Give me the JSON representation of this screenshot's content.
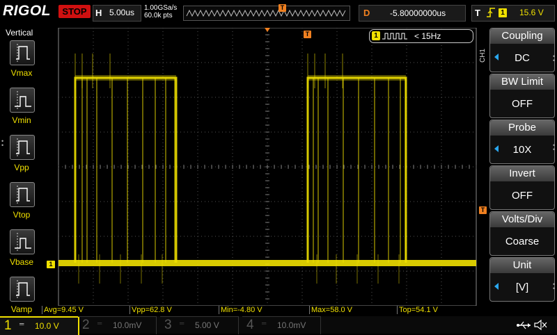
{
  "header": {
    "logo": "RIGOL",
    "run_status": "STOP",
    "timebase_letter": "H",
    "timebase_scale": "5.00us",
    "sample_rate": "1.00GSa/s",
    "memory_depth": "60.0k pts",
    "trigger_marker": "T",
    "delay_letter": "D",
    "delay_value": "-5.80000000us",
    "trigger_letter": "T",
    "trigger_edge": "rising-edge-icon",
    "trigger_channel": "1",
    "trigger_level": "15.6 V"
  },
  "left_panel": {
    "title": "Vertical",
    "items": [
      {
        "label": "Vmax",
        "icon": "vmax-icon"
      },
      {
        "label": "Vmin",
        "icon": "vmin-icon"
      },
      {
        "label": "Vpp",
        "icon": "vpp-icon"
      },
      {
        "label": "Vtop",
        "icon": "vtop-icon"
      },
      {
        "label": "Vbase",
        "icon": "vbase-icon"
      },
      {
        "label": "Vamp",
        "icon": "vamp-icon"
      }
    ]
  },
  "screen": {
    "freq_channel": "1",
    "freq_text": "< 15Hz",
    "channel_marker": "1",
    "trigger_position_marker": "T"
  },
  "right_menu": {
    "channel_tag": "CH1",
    "items": [
      {
        "title": "Coupling",
        "value": "DC"
      },
      {
        "title": "BW Limit",
        "value": "OFF"
      },
      {
        "title": "Probe",
        "value": "10X"
      },
      {
        "title": "Invert",
        "value": "OFF"
      },
      {
        "title": "Volts/Div",
        "value": "Coarse"
      },
      {
        "title": "Unit",
        "value": "[V]"
      }
    ]
  },
  "measurements": [
    {
      "text": "Avg=9.45 V"
    },
    {
      "text": "Vpp=62.8 V"
    },
    {
      "text": "Min=-4.80 V"
    },
    {
      "text": "Max=58.0 V"
    },
    {
      "text": "Top=54.1 V"
    }
  ],
  "channels": [
    {
      "num": "1",
      "scale": "10.0 V",
      "color": "#f0e000"
    },
    {
      "num": "2",
      "scale": "10.0mV",
      "color": "#28c0c0"
    },
    {
      "num": "3",
      "scale": "5.00 V",
      "color": "#d040d0"
    },
    {
      "num": "4",
      "scale": "10.0mV",
      "color": "#2a70e0"
    }
  ],
  "status_icons": [
    "usb-icon",
    "mute-icon"
  ],
  "colors": {
    "ch1": "#f0e000",
    "trigger": "#f08020",
    "stop": "#d01010"
  }
}
